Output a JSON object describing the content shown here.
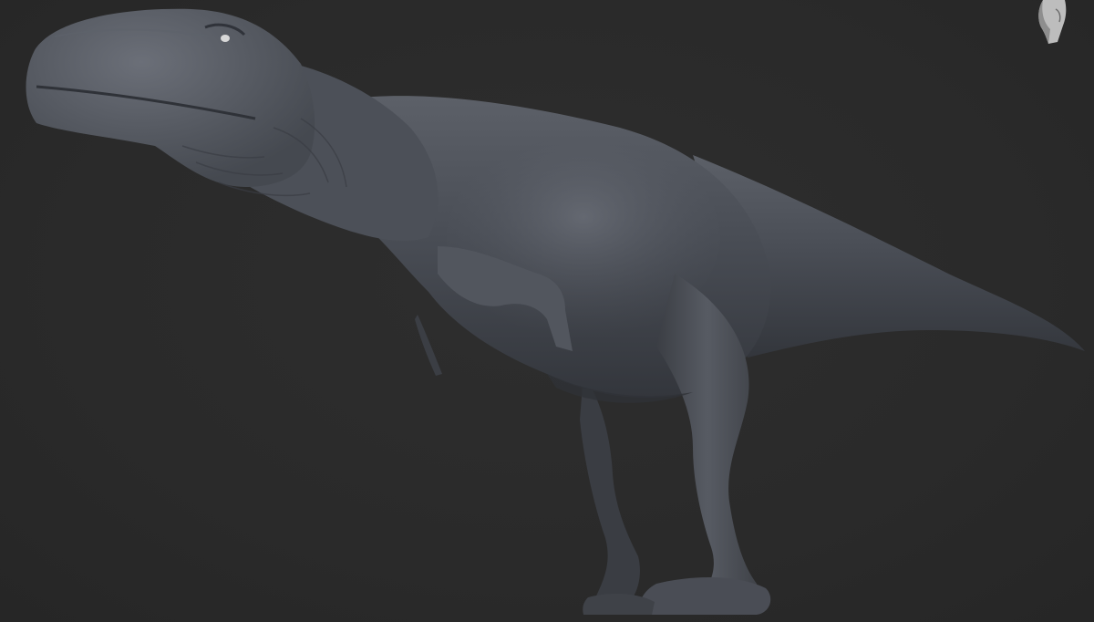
{
  "viewport": {
    "background": "#2a2a2a",
    "subject": "dinosaur-sculpt-model",
    "material_color": "#4d5058"
  },
  "navigation_gizmo": {
    "icon": "head-orientation-icon",
    "color": "#bdbdbd"
  }
}
